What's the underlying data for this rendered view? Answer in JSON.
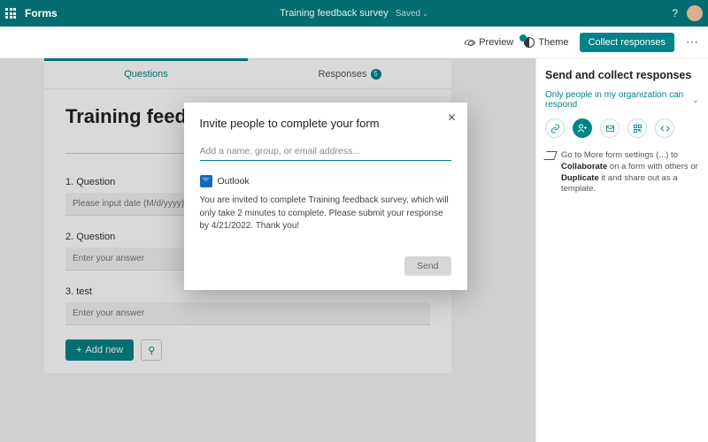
{
  "topbar": {
    "app_name": "Forms",
    "doc_title": "Training feedback survey",
    "save_state": "Saved"
  },
  "cmdbar": {
    "preview": "Preview",
    "theme": "Theme",
    "collect": "Collect responses"
  },
  "form": {
    "tabs": {
      "questions": "Questions",
      "responses": "Responses",
      "response_count": "5"
    },
    "title": "Training feedback",
    "questions": [
      {
        "label": "1. Question",
        "placeholder": "Please input date (M/d/yyyy)"
      },
      {
        "label": "2. Question",
        "placeholder": "Enter your answer"
      },
      {
        "label": "3. test",
        "placeholder": "Enter your answer"
      }
    ],
    "add_label": "Add new"
  },
  "panel": {
    "heading": "Send and collect responses",
    "permission": "Only people in my organization can respond",
    "tip_pre": "Go to More form settings (...) to ",
    "tip_b1": "Collaborate",
    "tip_mid": " on a form with others or ",
    "tip_b2": "Duplicate",
    "tip_post": " it and share out as a template."
  },
  "modal": {
    "title": "Invite people to complete your form",
    "placeholder": "Add a name, group, or email address...",
    "outlook": "Outlook",
    "message": "You are invited to complete Training feedback survey, which will only take 2 minutes to complete. Please submit your response by 4/21/2022.\nThank you!",
    "send": "Send"
  }
}
